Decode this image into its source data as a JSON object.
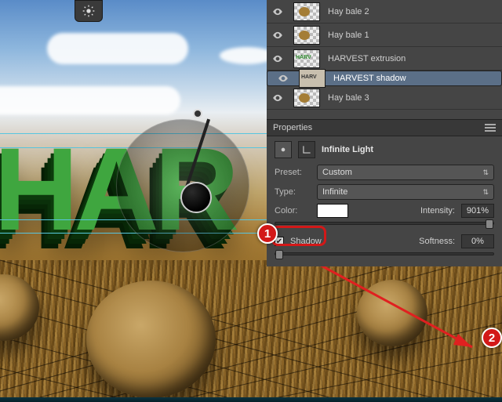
{
  "layers": {
    "items": [
      {
        "name": "Hay bale 2"
      },
      {
        "name": "Hay bale 1"
      },
      {
        "name": "HARVEST extrusion"
      },
      {
        "name": "HARVEST shadow"
      },
      {
        "name": "Hay bale 3"
      }
    ]
  },
  "properties": {
    "title": "Properties",
    "light_name": "Infinite Light",
    "preset_label": "Preset:",
    "preset_value": "Custom",
    "type_label": "Type:",
    "type_value": "Infinite",
    "color_label": "Color:",
    "intensity_label": "Intensity:",
    "intensity_value": "901%",
    "shadow_label": "Shadow",
    "softness_label": "Softness:",
    "softness_value": "0%"
  },
  "canvas": {
    "text3d": "HAR"
  },
  "callouts": {
    "one": "1",
    "two": "2"
  }
}
